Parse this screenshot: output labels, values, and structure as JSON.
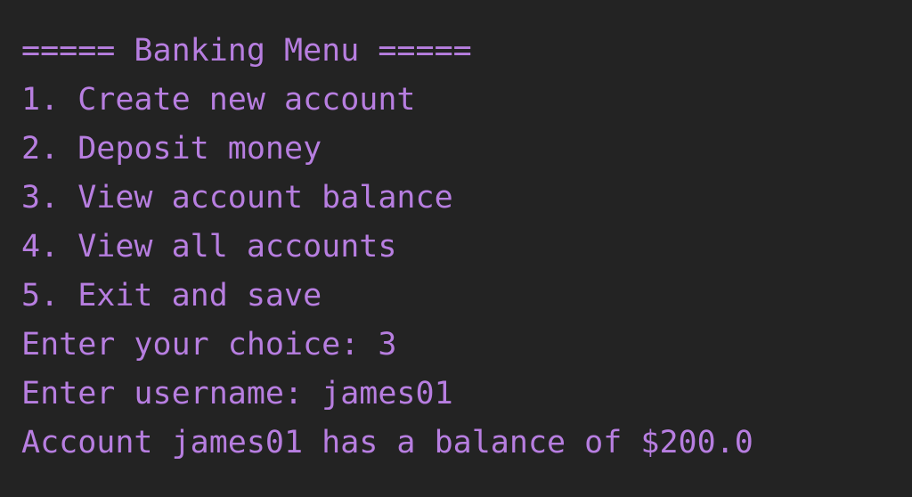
{
  "terminal": {
    "text_color": "#b77ee0",
    "background_color": "#232323",
    "lines": [
      "===== Banking Menu =====",
      "1. Create new account",
      "2. Deposit money",
      "3. View account balance",
      "4. View all accounts",
      "5. Exit and save",
      "Enter your choice: 3",
      "Enter username: james01",
      "Account james01 has a balance of $200.0"
    ]
  }
}
